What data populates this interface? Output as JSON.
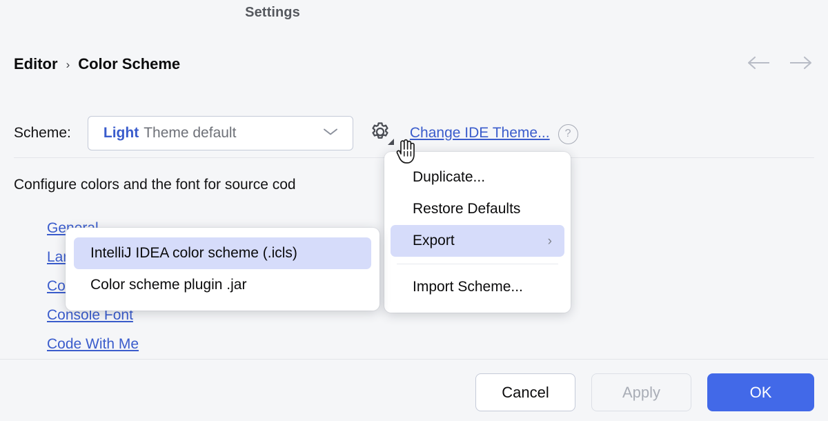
{
  "window": {
    "title": "Settings"
  },
  "breadcrumb": {
    "root": "Editor",
    "separator": "›",
    "current": "Color Scheme"
  },
  "nav": {
    "back_icon": "arrow-left-icon",
    "forward_icon": "arrow-right-icon"
  },
  "scheme": {
    "label": "Scheme:",
    "value_strong": "Light",
    "value_rest": "Theme default",
    "dropdown_icon": "chevron-down-icon",
    "gear_icon": "gear-icon",
    "change_theme_link": "Change IDE Theme...",
    "help_icon": "?",
    "accent_blue": "#3a5ccc"
  },
  "content": {
    "description": "Configure colors and the font for source cod",
    "links": [
      "General",
      "Language Defaults",
      "Color Scheme Font",
      "Console Font",
      "Code With Me"
    ]
  },
  "context_menu": {
    "items": [
      {
        "label": "Duplicate...",
        "selected": false,
        "has_submenu": false
      },
      {
        "label": "Restore Defaults",
        "selected": false,
        "has_submenu": false
      },
      {
        "label": "Export",
        "selected": true,
        "has_submenu": true,
        "submenu_arrow": "›"
      },
      {
        "label": "Import Scheme...",
        "selected": false,
        "has_submenu": false
      }
    ],
    "highlight_color": "#d6dcfa"
  },
  "export_submenu": {
    "items": [
      {
        "label": "IntelliJ IDEA color scheme (.icls)",
        "selected": true
      },
      {
        "label": "Color scheme plugin .jar",
        "selected": false
      }
    ]
  },
  "footer": {
    "cancel": "Cancel",
    "apply": "Apply",
    "ok": "OK",
    "ok_color": "#4269e8"
  }
}
